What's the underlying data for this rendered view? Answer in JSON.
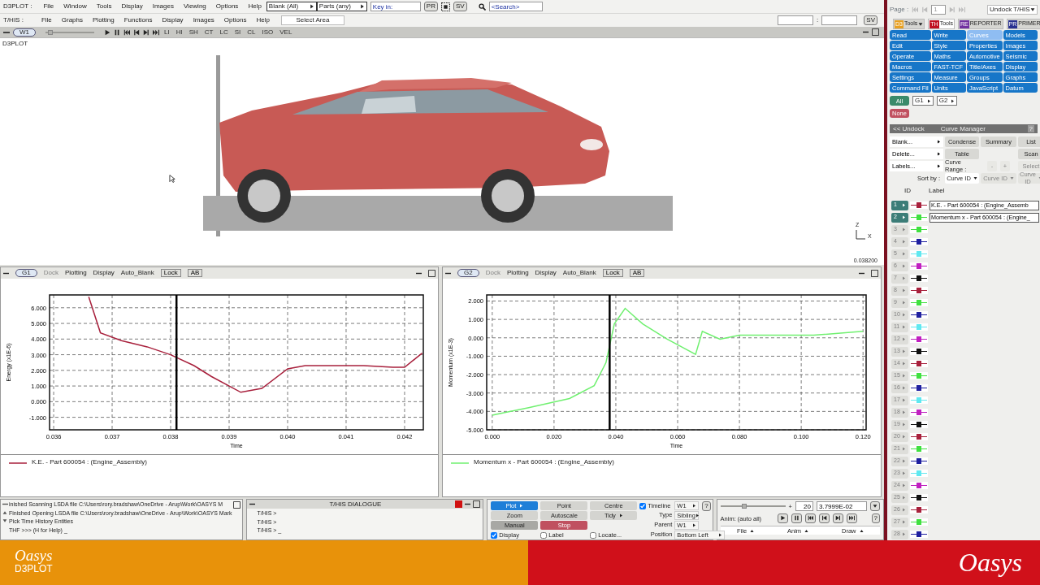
{
  "d3plot_menu": {
    "label": "D3PLOT :",
    "items": [
      "File",
      "Window",
      "Tools",
      "Display",
      "Images",
      "Viewing",
      "Options",
      "Help"
    ],
    "dropdowns": [
      "Blank (All)",
      "Parts (any)"
    ],
    "key_in": {
      "placeholder": "Key in:"
    },
    "pr_button": "PR",
    "sv_button": "SV",
    "search": {
      "placeholder": "<Search>"
    }
  },
  "this_menu": {
    "label": "T/HIS :",
    "items": [
      "File",
      "Graphs",
      "Plotting",
      "Functions",
      "Display",
      "Images",
      "Options",
      "Help"
    ],
    "select_area": "Select Area",
    "separator": ":",
    "sv_button": "SV"
  },
  "window_bar": {
    "tab": "W1",
    "slider": {
      "level": 0.05
    },
    "modes": [
      "LI",
      "HI",
      "SH",
      "CT",
      "LC",
      "SI",
      "CL",
      "ISO",
      "VEL"
    ]
  },
  "viewport": {
    "label": "D3PLOT",
    "picture": {
      "kind": "picture"
    },
    "axis_labels": [
      "Z",
      "X"
    ],
    "time": "0.038200"
  },
  "graphs": [
    {
      "tab": "G1",
      "toolbar": [
        {
          "label": "Dock",
          "kind": "menu",
          "disabled": true
        },
        {
          "label": "Plotting",
          "kind": "menu",
          "disabled": false
        },
        {
          "label": "Display",
          "kind": "menu",
          "disabled": false
        },
        {
          "label": "Auto_Blank",
          "kind": "menu",
          "disabled": false
        },
        {
          "label": "Lock",
          "kind": "toggle",
          "disabled": false
        },
        {
          "label": "AB",
          "kind": "toggle",
          "disabled": false
        }
      ],
      "chart_data": {
        "type": "line",
        "xlabel": "Time",
        "ylabel": "Energy (x1E-6)",
        "xlim": [
          0.03593,
          0.04232
        ],
        "ylim": [
          -1.8,
          6.82
        ],
        "xticks": [
          {
            "value": 0.036,
            "label": "0.036"
          },
          {
            "value": 0.037,
            "label": "0.037"
          },
          {
            "value": 0.038,
            "label": "0.038"
          },
          {
            "value": 0.039,
            "label": "0.039"
          },
          {
            "value": 0.04,
            "label": "0.040"
          },
          {
            "value": 0.041,
            "label": "0.041"
          },
          {
            "value": 0.042,
            "label": "0.042"
          }
        ],
        "yticks": [
          {
            "value": -1,
            "label": "-1.000"
          },
          {
            "value": 0,
            "label": "0.000"
          },
          {
            "value": 1,
            "label": "1.000"
          },
          {
            "value": 2,
            "label": "2.000"
          },
          {
            "value": 3,
            "label": "3.000"
          },
          {
            "value": 4,
            "label": "4.000"
          },
          {
            "value": 5,
            "label": "5.000"
          },
          {
            "value": 6,
            "label": "6.000"
          }
        ],
        "x": [
          0.0366,
          0.0368,
          0.03716,
          0.0376,
          0.038,
          0.0384,
          0.0387,
          0.0392,
          0.03956,
          0.04,
          0.0403,
          0.0406,
          0.0413,
          0.0418,
          0.042,
          0.0423
        ],
        "series": [
          {
            "name": "K.E. - Part 600054 : (Engine_Assembly)",
            "color": "#a8203c",
            "values": [
              6.7,
              4.4,
              3.9,
              3.5,
              3.0,
              2.3,
              1.6,
              0.6,
              0.85,
              2.1,
              2.3,
              2.3,
              2.3,
              2.2,
              2.2,
              3.1
            ]
          }
        ],
        "grid": true,
        "ref_lines": [
          {
            "axis": "x",
            "value": 0.0381
          }
        ]
      }
    },
    {
      "tab": "G2",
      "toolbar": [
        {
          "label": "Dock",
          "kind": "menu",
          "disabled": true
        },
        {
          "label": "Plotting",
          "kind": "menu",
          "disabled": false
        },
        {
          "label": "Display",
          "kind": "menu",
          "disabled": false
        },
        {
          "label": "Auto_Blank",
          "kind": "menu",
          "disabled": false
        },
        {
          "label": "Lock",
          "kind": "toggle",
          "disabled": false
        },
        {
          "label": "AB",
          "kind": "toggle",
          "disabled": false
        }
      ],
      "chart_data": {
        "type": "line",
        "xlabel": "Time",
        "ylabel": "Momentum (x1E-3)",
        "xlim": [
          -0.0018,
          0.121
        ],
        "ylim": [
          -5.0,
          2.33
        ],
        "xticks": [
          {
            "value": 0,
            "label": "0.000"
          },
          {
            "value": 0.02,
            "label": "0.020"
          },
          {
            "value": 0.04,
            "label": "0.040"
          },
          {
            "value": 0.06,
            "label": "0.060"
          },
          {
            "value": 0.08,
            "label": "0.080"
          },
          {
            "value": 0.1,
            "label": "0.100"
          },
          {
            "value": 0.12,
            "label": "0.120"
          }
        ],
        "yticks": [
          {
            "value": -5,
            "label": "-5.000"
          },
          {
            "value": -4,
            "label": "-4.000"
          },
          {
            "value": -3,
            "label": "-3.000"
          },
          {
            "value": -2,
            "label": "-2.000"
          },
          {
            "value": -1,
            "label": "-1.000"
          },
          {
            "value": 0,
            "label": "0.000"
          },
          {
            "value": 1,
            "label": "1.000"
          },
          {
            "value": 2,
            "label": "2.000"
          }
        ],
        "x": [
          0,
          0.0118,
          0.025,
          0.033,
          0.0368,
          0.0395,
          0.043,
          0.0487,
          0.0566,
          0.0658,
          0.068,
          0.0737,
          0.08,
          0.104,
          0.12
        ],
        "series": [
          {
            "name": "Momentum x - Part 600054 : (Engine_Assembly)",
            "color": "#70f070",
            "values": [
              -4.2,
              -3.8,
              -3.3,
              -2.6,
              -1.35,
              0.76,
              1.6,
              0.76,
              -0.07,
              -0.9,
              0.35,
              -0.07,
              0.14,
              0.14,
              0.35
            ]
          }
        ],
        "grid": true,
        "ref_lines": [
          {
            "axis": "x",
            "value": 0.038
          }
        ]
      }
    }
  ],
  "console": {
    "lines": [
      "inished Scanning LSDA file C:\\Users\\rory.bradshaw\\OneDrive - Arup\\Work\\OASYS M",
      "Finished Opening LSDA file C:\\Users\\rory.bradshaw\\OneDrive - Arup\\Work\\OASYS Mark",
      "Pick Time History Entities",
      "THF >>> (H for Help) _"
    ]
  },
  "dialogue": {
    "title": "T/HIS DIALOGUE",
    "lines": [
      "T/HIS >",
      "T/HIS >",
      "T/HIS > _"
    ]
  },
  "plot_controls": {
    "button_rows": [
      [
        {
          "label": "Plot",
          "kind": "active",
          "menu": true
        },
        {
          "label": "Point",
          "kind": "normal",
          "menu": false
        },
        {
          "label": "Centre",
          "kind": "normal",
          "menu": false
        }
      ],
      [
        {
          "label": "Zoom",
          "kind": "normal",
          "menu": false
        },
        {
          "label": "Autoscale",
          "kind": "normal",
          "menu": false
        },
        {
          "label": "Tidy",
          "kind": "normal",
          "menu": true
        }
      ],
      [
        {
          "label": "Manual",
          "kind": "pressed",
          "menu": false
        },
        {
          "label": "Stop",
          "kind": "stop",
          "menu": false
        }
      ]
    ],
    "timeline": {
      "label": "Timeline",
      "checked": true,
      "value": "W1"
    },
    "type": {
      "label": "Type",
      "value": "Sibling"
    },
    "parent": {
      "label": "Parent",
      "value": "W1"
    },
    "checkboxes": [
      {
        "label": "Display",
        "checked": true
      },
      {
        "label": "Label",
        "checked": false
      },
      {
        "label": "Locate...",
        "checked": false
      }
    ],
    "position": {
      "label": "Position",
      "value": "Bottom Left"
    },
    "help": "?"
  },
  "anim": {
    "slider": {
      "level": 0.35,
      "plus": "+"
    },
    "frame": "20",
    "time": "3.7999E-02",
    "label": "Anim: (auto all)",
    "help": "?",
    "menus": [
      "File",
      "Anim",
      "Draw"
    ]
  },
  "right_panel": {
    "page_label": "Page :",
    "page": "1",
    "undock": "Undock T/HIS",
    "tabs": [
      {
        "badge": "D3",
        "color": "#e8a020",
        "label": "Tools",
        "caret": true,
        "selected": false
      },
      {
        "badge": "TH",
        "color": "#c01020",
        "label": "Tools",
        "caret": false,
        "selected": true
      },
      {
        "badge": "RE",
        "color": "#7030a0",
        "label": "REPORTER",
        "caret": false,
        "selected": false
      },
      {
        "badge": "PR",
        "color": "#283090",
        "label": "PRIMER",
        "caret": false,
        "selected": false
      }
    ],
    "tools": [
      {
        "label": "Read",
        "selected": false
      },
      {
        "label": "Write",
        "selected": false
      },
      {
        "label": "Curves",
        "selected": true
      },
      {
        "label": "Models",
        "selected": false
      },
      {
        "label": "Edit",
        "selected": false
      },
      {
        "label": "Style",
        "selected": false
      },
      {
        "label": "Properties",
        "selected": false
      },
      {
        "label": "Images",
        "selected": false
      },
      {
        "label": "Operate",
        "selected": false
      },
      {
        "label": "Maths",
        "selected": false
      },
      {
        "label": "Automotive",
        "selected": false
      },
      {
        "label": "Seismic",
        "selected": false
      },
      {
        "label": "Macros",
        "selected": false
      },
      {
        "label": "FAST-TCF",
        "selected": false
      },
      {
        "label": "Title/Axes",
        "selected": false
      },
      {
        "label": "Display",
        "selected": false
      },
      {
        "label": "Settings",
        "selected": false
      },
      {
        "label": "Measure",
        "selected": false
      },
      {
        "label": "Groups",
        "selected": false
      },
      {
        "label": "Graphs",
        "selected": false
      },
      {
        "label": "Command Fil",
        "selected": false
      },
      {
        "label": "Units",
        "selected": false
      },
      {
        "label": "JavaScript",
        "selected": false
      },
      {
        "label": "Datum",
        "selected": false
      }
    ],
    "groups": {
      "all": "All",
      "graphs": [
        "G1",
        "G2"
      ],
      "none": "None"
    }
  },
  "curve_manager": {
    "undock": "<< Undock",
    "title": "Curve Manager",
    "help": "?",
    "menus": [
      "Blank...",
      "Delete...",
      "Labels..."
    ],
    "condense": "Condense",
    "summary": "Summary",
    "list": "List",
    "table": "Table",
    "scan": "Scan",
    "range_label": "Curve Range :",
    "range_buttons": [
      {
        "label": "-",
        "disabled": true
      },
      {
        "label": "+",
        "disabled": true
      }
    ],
    "select": {
      "label": "Select",
      "disabled": true
    },
    "sort_label": "Sort by :",
    "sort_fields": [
      {
        "label": "Curve ID",
        "disabled": false
      },
      {
        "label": "Curve ID",
        "disabled": true
      },
      {
        "label": "Curve ID",
        "disabled": true
      }
    ],
    "columns": [
      "ID",
      "Label"
    ],
    "curves": [
      {
        "id": "1",
        "active": true,
        "color": "#a8203c",
        "label": "K.E. - Part 600054 : (Engine_Assemb"
      },
      {
        "id": "2",
        "active": true,
        "color": "#40e040",
        "label": "Momentum x - Part 600054 : (Engine_"
      },
      {
        "id": "3",
        "active": false,
        "color": "#40e040"
      },
      {
        "id": "4",
        "active": false,
        "color": "#2020a0"
      },
      {
        "id": "5",
        "active": false,
        "color": "#60e8f0"
      },
      {
        "id": "6",
        "active": false,
        "color": "#c020c0"
      },
      {
        "id": "7",
        "active": false,
        "color": "#111111"
      },
      {
        "id": "8",
        "active": false,
        "color": "#a8203c"
      },
      {
        "id": "9",
        "active": false,
        "color": "#40e040"
      },
      {
        "id": "10",
        "active": false,
        "color": "#2020a0"
      },
      {
        "id": "11",
        "active": false,
        "color": "#60e8f0"
      },
      {
        "id": "12",
        "active": false,
        "color": "#c020c0"
      },
      {
        "id": "13",
        "active": false,
        "color": "#111111"
      },
      {
        "id": "14",
        "active": false,
        "color": "#a8203c"
      },
      {
        "id": "15",
        "active": false,
        "color": "#40e040"
      },
      {
        "id": "16",
        "active": false,
        "color": "#2020a0"
      },
      {
        "id": "17",
        "active": false,
        "color": "#60e8f0"
      },
      {
        "id": "18",
        "active": false,
        "color": "#c020c0"
      },
      {
        "id": "19",
        "active": false,
        "color": "#111111"
      },
      {
        "id": "20",
        "active": false,
        "color": "#a8203c"
      },
      {
        "id": "21",
        "active": false,
        "color": "#40e040"
      },
      {
        "id": "22",
        "active": false,
        "color": "#2020a0"
      },
      {
        "id": "23",
        "active": false,
        "color": "#60e8f0"
      },
      {
        "id": "24",
        "active": false,
        "color": "#c020c0"
      },
      {
        "id": "25",
        "active": false,
        "color": "#111111"
      },
      {
        "id": "26",
        "active": false,
        "color": "#a8203c"
      },
      {
        "id": "27",
        "active": false,
        "color": "#40e040"
      },
      {
        "id": "28",
        "active": false,
        "color": "#2020a0"
      }
    ]
  },
  "footer": {
    "brand": "Oasys",
    "product": "D3PLOT",
    "brand_right": "Oasys"
  }
}
